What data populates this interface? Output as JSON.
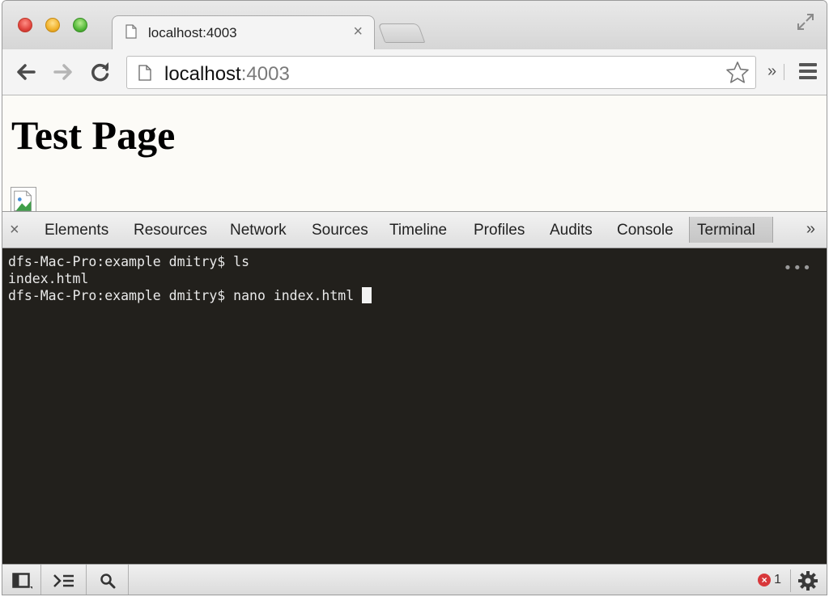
{
  "browser": {
    "tab": {
      "title": "localhost:4003",
      "close_glyph": "×",
      "icon": "page-icon"
    },
    "address": {
      "host": "localhost",
      "port": ":4003"
    },
    "toolbar_icons": [
      "back-icon",
      "forward-icon",
      "reload-icon",
      "star-icon",
      "extensions-chevron-icon",
      "menu-icon"
    ],
    "extensions_glyph": "»"
  },
  "page": {
    "heading": "Test Page",
    "image": "broken-image-icon"
  },
  "devtools": {
    "close_glyph": "×",
    "tabs": [
      {
        "label": "Elements"
      },
      {
        "label": "Resources"
      },
      {
        "label": "Network"
      },
      {
        "label": "Sources"
      },
      {
        "label": "Timeline"
      },
      {
        "label": "Profiles"
      },
      {
        "label": "Audits"
      },
      {
        "label": "Console"
      },
      {
        "label": "Terminal",
        "active": true
      }
    ],
    "more_glyph": "»",
    "terminal": {
      "lines": [
        "dfs-Mac-Pro:example dmitry$ ls",
        "index.html",
        "dfs-Mac-Pro:example dmitry$ nano index.html "
      ],
      "menu_glyph": "•••"
    },
    "statusbar": {
      "buttons": [
        "dock-icon",
        "console-drawer-icon",
        "search-icon"
      ],
      "error_count": "1",
      "error_glyph": "×",
      "settings": "gear-icon"
    }
  },
  "colors": {
    "terminal_bg": "#22201c",
    "terminal_fg": "#e9e9e9",
    "error_red": "#d8383b"
  }
}
